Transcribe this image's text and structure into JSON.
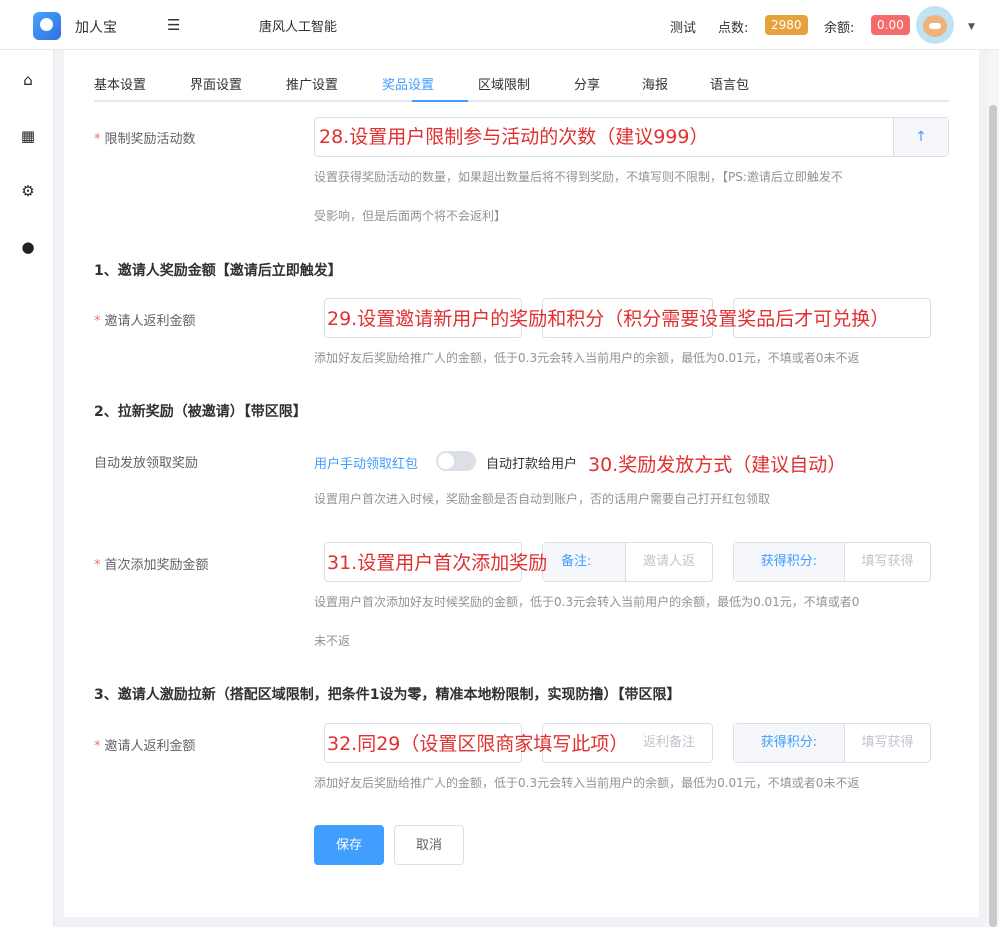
{
  "header": {
    "app_name": "加人宝",
    "company": "唐风人工智能",
    "test_label": "测试",
    "points_label": "点数:",
    "points_value": "2980",
    "balance_label": "余额:",
    "balance_value": "0.00"
  },
  "tabs": [
    "基本设置",
    "界面设置",
    "推广设置",
    "奖品设置",
    "区域限制",
    "分享",
    "海报",
    "语言包"
  ],
  "active_tab": "奖品设置",
  "limit": {
    "label": "限制奖励活动数",
    "annotation": "28.设置用户限制参与活动的次数（建议999）",
    "up_icon": "↑",
    "help_line1": "设置获得奖励活动的数量，如果超出数量后将不得到奖励，不填写则不限制，【PS:邀请后立即触发不",
    "help_line2": "受影响，但是后面两个将不会返利】"
  },
  "section1": {
    "title": "1、邀请人奖励金额【邀请后立即触发】",
    "label": "邀请人返利金额",
    "annotation": "29.设置邀请新用户的奖励和积分（积分需要设置奖品后才可兑换）",
    "help": "添加好友后奖励给推广人的金额，低于0.3元会转入当前用户的余额，最低为0.01元，不填或者0未不返"
  },
  "section2": {
    "title": "2、拉新奖励（被邀请）【带区限】",
    "auto_label": "自动发放领取奖励",
    "manual_option": "用户手动领取红包",
    "auto_option": "自动打款给用户",
    "annotation_auto": "30.奖励发放方式（建议自动）",
    "auto_help": "设置用户首次进入时候，奖励金额是否自动到账户，否的话用户需要自己打开红包领取",
    "first_label": "首次添加奖励金额",
    "annotation_first": "31.设置用户首次添加奖励",
    "remark_label": "备注:",
    "remark_placeholder": "邀请人返",
    "points_label": "获得积分:",
    "points_placeholder": "填写获得",
    "first_help_line1": "设置用户首次添加好友时候奖励的金额，低于0.3元会转入当前用户的余额，最低为0.01元，不填或者0",
    "first_help_line2": "未不返"
  },
  "section3": {
    "title": "3、邀请人激励拉新（搭配区域限制，把条件1设为零，精准本地粉限制，实现防撸）【带区限】",
    "label": "邀请人返利金额",
    "annotation": "32.同29（设置区限商家填写此项）",
    "remark_placeholder": "返利备注",
    "points_label": "获得积分:",
    "points_placeholder": "填写获得",
    "help": "添加好友后奖励给推广人的金额，低于0.3元会转入当前用户的余额，最低为0.01元，不填或者0未不返"
  },
  "actions": {
    "save": "保存",
    "cancel": "取消"
  }
}
